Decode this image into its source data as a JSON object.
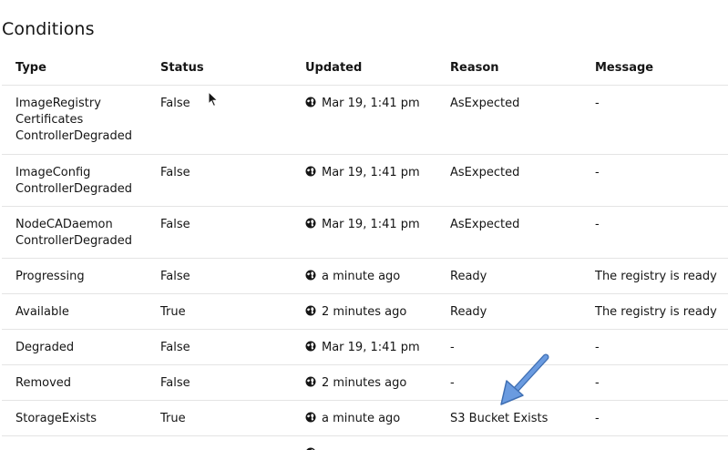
{
  "section": {
    "title": "Conditions"
  },
  "table": {
    "headers": {
      "type": "Type",
      "status": "Status",
      "updated": "Updated",
      "reason": "Reason",
      "message": "Message"
    },
    "rows": [
      {
        "type_lines": [
          "ImageRegistry",
          "Certificates",
          "ControllerDegraded"
        ],
        "status": "False",
        "updated": "Mar 19, 1:41 pm",
        "reason": "AsExpected",
        "message": "-"
      },
      {
        "type_lines": [
          "ImageConfig",
          "ControllerDegraded"
        ],
        "status": "False",
        "updated": "Mar 19, 1:41 pm",
        "reason": "AsExpected",
        "message": "-"
      },
      {
        "type_lines": [
          "NodeCADaemon",
          "ControllerDegraded"
        ],
        "status": "False",
        "updated": "Mar 19, 1:41 pm",
        "reason": "AsExpected",
        "message": "-"
      },
      {
        "type_lines": [
          "Progressing"
        ],
        "status": "False",
        "updated": "a minute ago",
        "reason": "Ready",
        "message": "The registry is ready"
      },
      {
        "type_lines": [
          "Available"
        ],
        "status": "True",
        "updated": "2 minutes ago",
        "reason": "Ready",
        "message": "The registry is ready"
      },
      {
        "type_lines": [
          "Degraded"
        ],
        "status": "False",
        "updated": "Mar 19, 1:41 pm",
        "reason": "-",
        "message": "-"
      },
      {
        "type_lines": [
          "Removed"
        ],
        "status": "False",
        "updated": "2 minutes ago",
        "reason": "-",
        "message": "-"
      },
      {
        "type_lines": [
          "StorageExists"
        ],
        "status": "True",
        "updated": "a minute ago",
        "reason": "S3 Bucket Exists",
        "message": "-"
      }
    ]
  },
  "icons": {
    "timestamp": "globe-icon",
    "pointer": "mouse-cursor-icon",
    "annotation": "arrow-annotation-icon"
  },
  "colors": {
    "text": "#151515",
    "divider": "#e4e4e4",
    "annotation_arrow": "#5b8fd6"
  }
}
